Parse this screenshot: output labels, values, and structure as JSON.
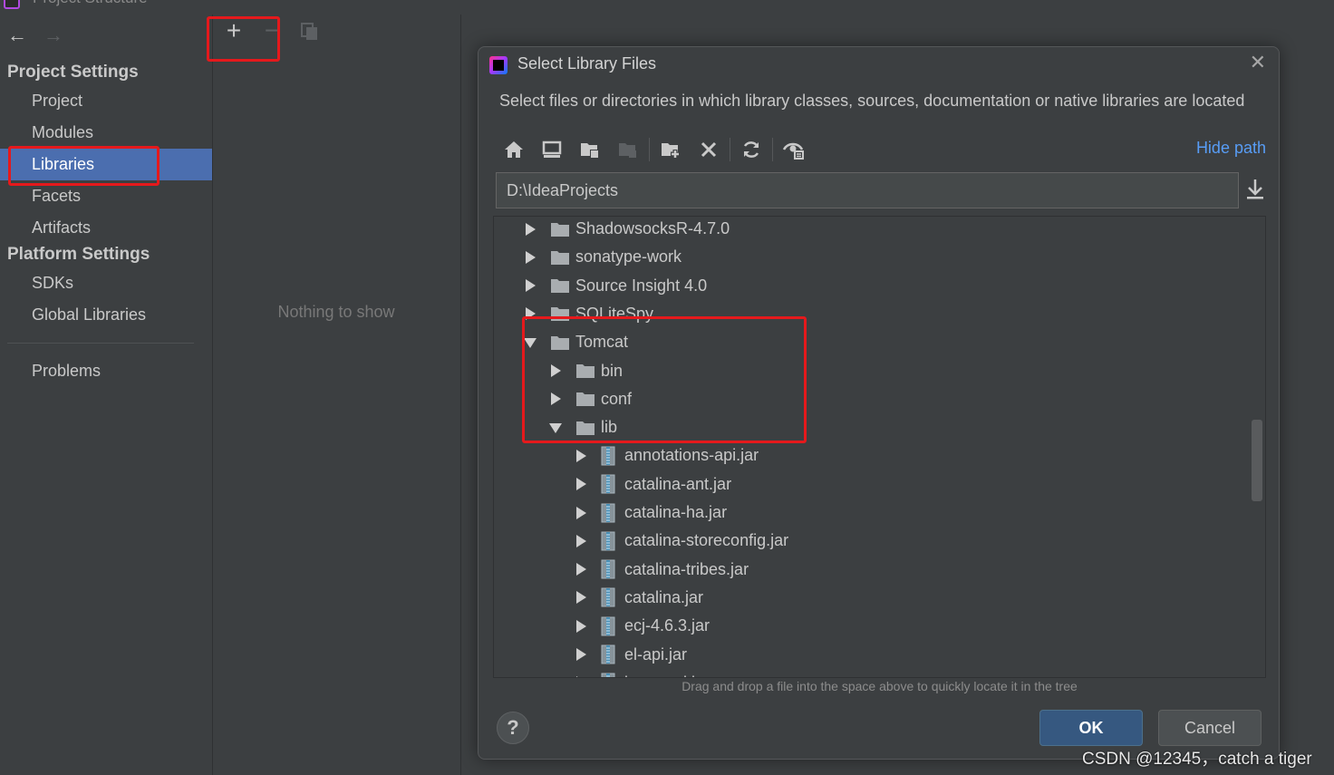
{
  "window": {
    "title": "Project Structure"
  },
  "nav": {
    "back_icon": "arrow-left-icon",
    "forward_icon": "arrow-right-icon",
    "project_settings_header": "Project Settings",
    "platform_settings_header": "Platform Settings",
    "items": [
      {
        "label": "Project"
      },
      {
        "label": "Modules"
      },
      {
        "label": "Libraries"
      },
      {
        "label": "Facets"
      },
      {
        "label": "Artifacts"
      }
    ],
    "platform_items": [
      {
        "label": "SDKs"
      },
      {
        "label": "Global Libraries"
      }
    ],
    "problems_label": "Problems",
    "selected": "Libraries"
  },
  "middle": {
    "add_symbol": "+",
    "remove_symbol": "−",
    "empty_text": "Nothing to show"
  },
  "dialog": {
    "title": "Select Library Files",
    "close_symbol": "✕",
    "description": "Select files or directories in which library classes, sources, documentation or native libraries are located",
    "hide_path_label": "Hide path",
    "path_value": "D:\\IdeaProjects",
    "toolbar_icons": [
      "home-icon",
      "desktop-icon",
      "project-folder-icon",
      "module-folder-icon",
      "new-folder-icon",
      "delete-icon",
      "refresh-icon",
      "show-hidden-icon"
    ],
    "tree": [
      {
        "label": "ShadowsocksR-4.7.0",
        "type": "folder",
        "expanded": false,
        "level": 0
      },
      {
        "label": "sonatype-work",
        "type": "folder",
        "expanded": false,
        "level": 0
      },
      {
        "label": "Source Insight 4.0",
        "type": "folder",
        "expanded": false,
        "level": 0
      },
      {
        "label": "SQLiteSpy",
        "type": "folder",
        "expanded": false,
        "level": 0
      },
      {
        "label": "Tomcat",
        "type": "folder",
        "expanded": true,
        "level": 0
      },
      {
        "label": "bin",
        "type": "folder",
        "expanded": false,
        "level": 1
      },
      {
        "label": "conf",
        "type": "folder",
        "expanded": false,
        "level": 1
      },
      {
        "label": "lib",
        "type": "folder",
        "expanded": true,
        "level": 1
      },
      {
        "label": "annotations-api.jar",
        "type": "jar",
        "expanded": false,
        "level": 2
      },
      {
        "label": "catalina-ant.jar",
        "type": "jar",
        "expanded": false,
        "level": 2
      },
      {
        "label": "catalina-ha.jar",
        "type": "jar",
        "expanded": false,
        "level": 2
      },
      {
        "label": "catalina-storeconfig.jar",
        "type": "jar",
        "expanded": false,
        "level": 2
      },
      {
        "label": "catalina-tribes.jar",
        "type": "jar",
        "expanded": false,
        "level": 2
      },
      {
        "label": "catalina.jar",
        "type": "jar",
        "expanded": false,
        "level": 2
      },
      {
        "label": "ecj-4.6.3.jar",
        "type": "jar",
        "expanded": false,
        "level": 2
      },
      {
        "label": "el-api.jar",
        "type": "jar",
        "expanded": false,
        "level": 2
      },
      {
        "label": "jasper-el.jar",
        "type": "jar",
        "expanded": false,
        "level": 2
      }
    ],
    "hint": "Drag and drop a file into the space above to quickly locate it in the tree",
    "help_symbol": "?",
    "ok_label": "OK",
    "cancel_label": "Cancel"
  },
  "watermark": "CSDN @12345，catch a tiger",
  "colors": {
    "background": "#3c3f41",
    "selection": "#4b6eaf",
    "link": "#589df6",
    "ok_button": "#365880",
    "annotation_red": "#e5191c"
  }
}
